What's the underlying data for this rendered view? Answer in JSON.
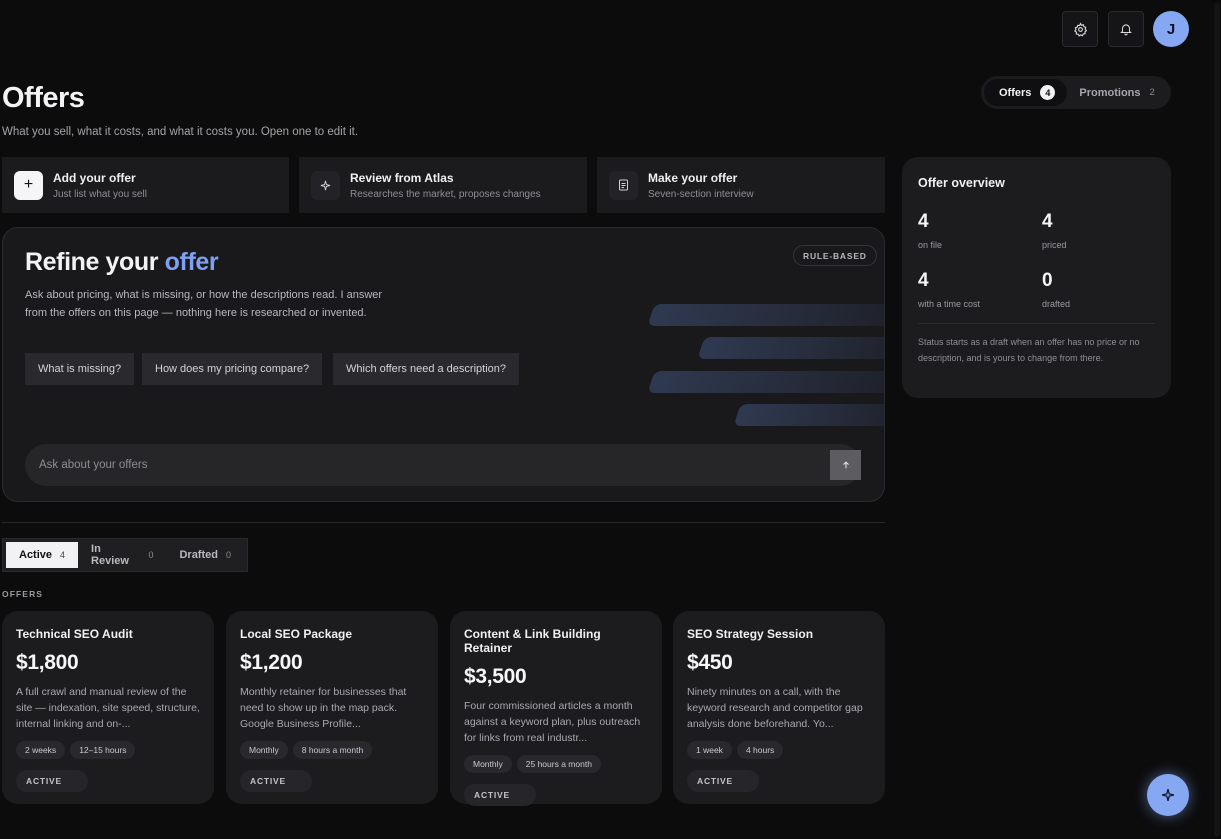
{
  "header": {
    "settings_icon": "gear-icon",
    "notifications_icon": "bell-icon",
    "avatar_initial": "J",
    "avatar_color": "#86a8f2"
  },
  "page": {
    "title": "Offers",
    "subtitle": "What you sell, what it costs, and what it costs you. Open one to edit it."
  },
  "top_tabs": [
    {
      "label": "Offers",
      "count": "4"
    },
    {
      "label": "Promotions",
      "count": "2"
    }
  ],
  "actions": [
    {
      "title": "Add your offer",
      "desc": "Just list what you sell",
      "icon": "plus-icon"
    },
    {
      "title": "Review from Atlas",
      "desc": "Researches the market, proposes changes",
      "icon": "sparkle-icon"
    },
    {
      "title": "Make your offer",
      "desc": "Seven-section interview",
      "icon": "document-icon"
    }
  ],
  "refine": {
    "title_prefix": "Refine your",
    "title_accent": "offer",
    "accent_color": "#7f9ff0",
    "description": "Ask about pricing, what is missing, or how the descriptions read. I answer from the offers on this page — nothing here is researched or invented.",
    "badge": "RULE-BASED",
    "chips": [
      "What is missing?",
      "How does my pricing compare?",
      "Which offers need a description?"
    ],
    "input_placeholder": "Ask about your offers",
    "send_icon": "arrow-up-icon"
  },
  "status_tabs": [
    {
      "label": "Active",
      "count": "4"
    },
    {
      "label": "In Review",
      "count": "0"
    },
    {
      "label": "Drafted",
      "count": "0"
    }
  ],
  "section_label": "OFFERS",
  "offers": [
    {
      "name": "Technical SEO Audit",
      "price": "$1,800",
      "desc": "A full crawl and manual review of the site — indexation, site speed, structure, internal linking and on-...",
      "tags": [
        "2 weeks",
        "12–15 hours"
      ],
      "status": "ACTIVE"
    },
    {
      "name": "Local SEO Package",
      "price": "$1,200",
      "desc": "Monthly retainer for businesses that need to show up in the map pack. Google Business Profile...",
      "tags": [
        "Monthly",
        "8 hours a month"
      ],
      "status": "ACTIVE"
    },
    {
      "name": "Content & Link Building Retainer",
      "price": "$3,500",
      "desc": "Four commissioned articles a month against a keyword plan, plus outreach for links from real industr...",
      "tags": [
        "Monthly",
        "25 hours a month"
      ],
      "status": "ACTIVE"
    },
    {
      "name": "SEO Strategy Session",
      "price": "$450",
      "desc": "Ninety minutes on a call, with the keyword research and competitor gap analysis done beforehand. Yo...",
      "tags": [
        "1 week",
        "4 hours"
      ],
      "status": "ACTIVE"
    }
  ],
  "overview": {
    "title": "Offer overview",
    "stats": [
      {
        "value": "4",
        "label": "on file"
      },
      {
        "value": "4",
        "label": "priced"
      },
      {
        "value": "4",
        "label": "with a time cost"
      },
      {
        "value": "0",
        "label": "drafted"
      }
    ],
    "note": "Status starts as a draft when an offer has no price or no description, and is yours to change from there."
  },
  "fab_icon": "sparkle-icon"
}
